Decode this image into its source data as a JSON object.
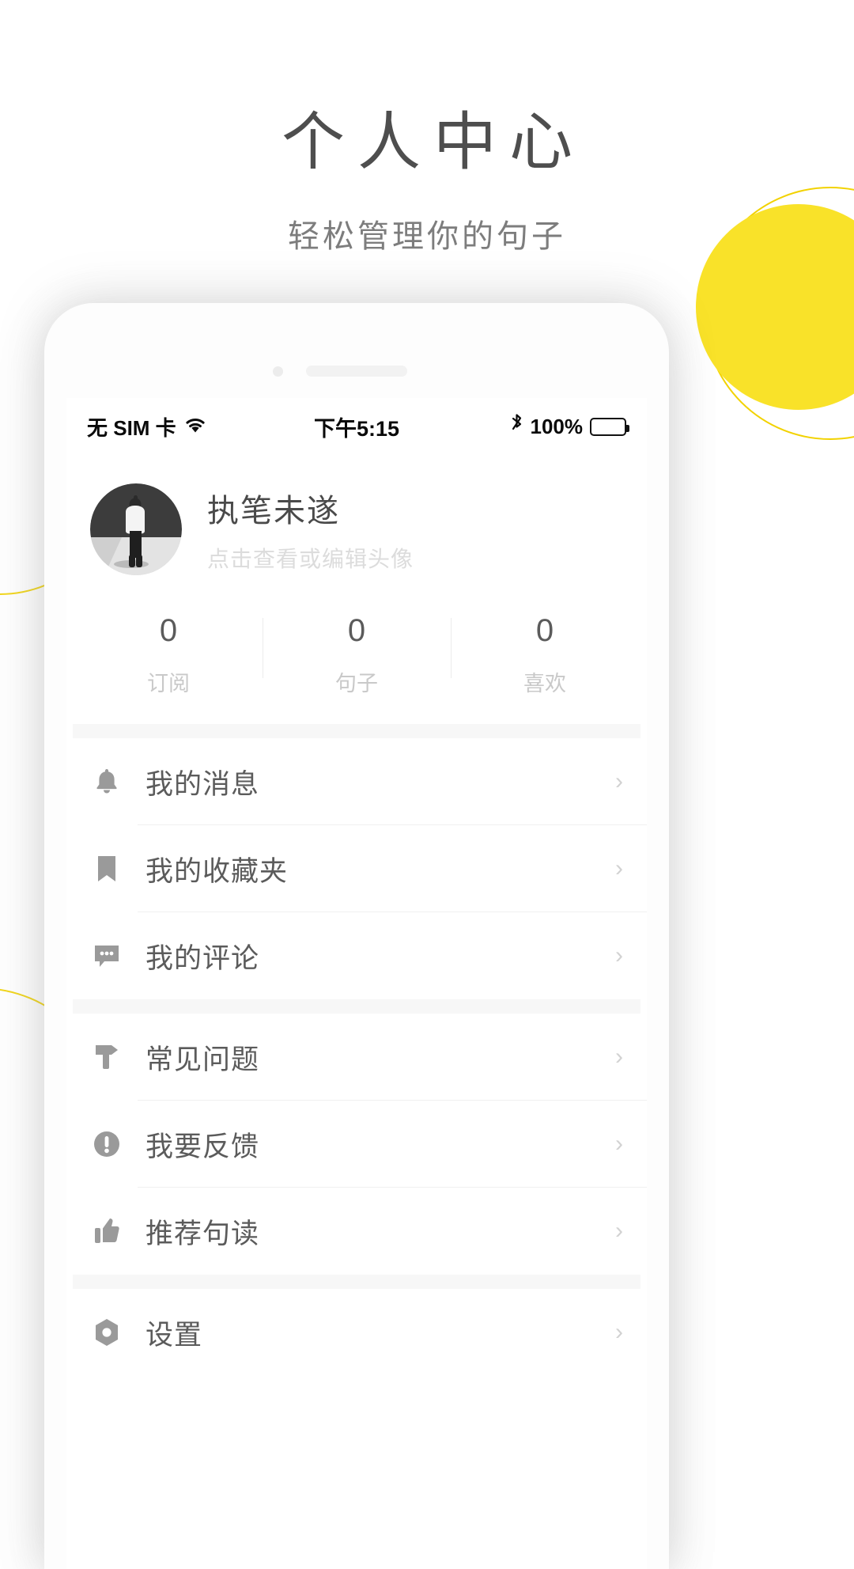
{
  "page": {
    "title": "个人中心",
    "subtitle": "轻松管理你的句子"
  },
  "colors": {
    "accent_yellow": "#f9e229",
    "ring_yellow": "#f2d200",
    "title_gray": "#4e4e4e",
    "subtitle_gray": "#7d7d7d",
    "menu_text": "#5b5b5b",
    "icon_gray": "#9a9a9a",
    "divider": "#f0f0f0",
    "group_gap": "#f7f7f7"
  },
  "status_bar": {
    "carrier": "无 SIM 卡",
    "wifi_icon": "wifi-icon",
    "time": "下午5:15",
    "bluetooth_icon": "bluetooth-icon",
    "battery_percent": "100%",
    "battery_icon": "battery-full-icon"
  },
  "profile": {
    "avatar_icon": "avatar-photo",
    "name": "执笔未遂",
    "hint": "点击查看或编辑头像"
  },
  "stats": [
    {
      "value": "0",
      "label": "订阅"
    },
    {
      "value": "0",
      "label": "句子"
    },
    {
      "value": "0",
      "label": "喜欢"
    }
  ],
  "menu_groups": [
    {
      "items": [
        {
          "label": "我的消息",
          "icon": "bell-icon",
          "chevron": "›"
        },
        {
          "label": "我的收藏夹",
          "icon": "bookmark-icon",
          "chevron": "›"
        },
        {
          "label": "我的评论",
          "icon": "comment-icon",
          "chevron": "›"
        }
      ]
    },
    {
      "items": [
        {
          "label": "常见问题",
          "icon": "signpost-icon",
          "chevron": "›"
        },
        {
          "label": "我要反馈",
          "icon": "exclamation-circle-icon",
          "chevron": "›"
        },
        {
          "label": "推荐句读",
          "icon": "thumbs-up-icon",
          "chevron": "›"
        }
      ]
    },
    {
      "items": [
        {
          "label": "设置",
          "icon": "gear-icon",
          "chevron": "›"
        }
      ]
    }
  ]
}
